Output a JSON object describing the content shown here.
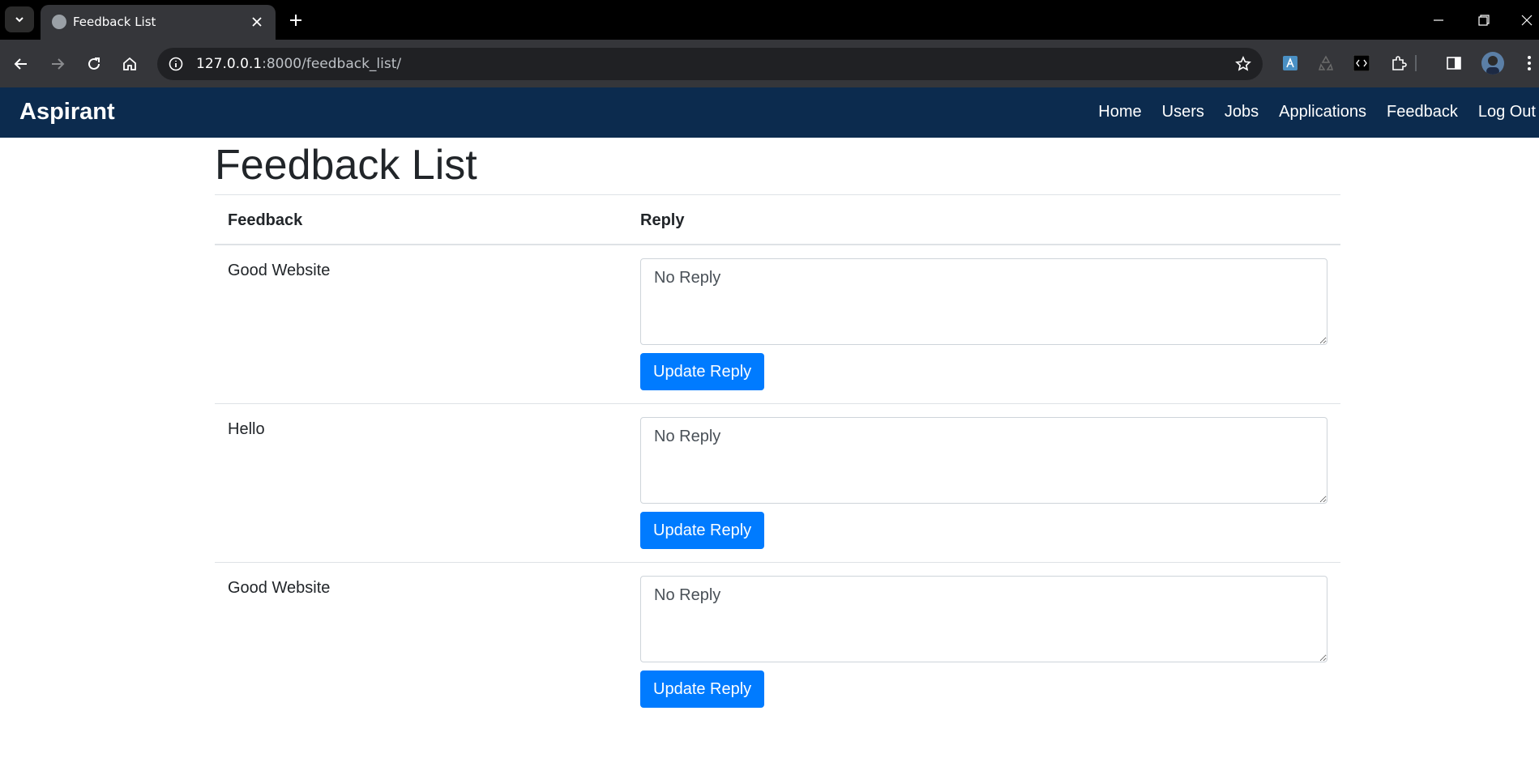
{
  "browser": {
    "tab_title": "Feedback List",
    "url_host": "127.0.0.1",
    "url_rest": ":8000/feedback_list/"
  },
  "navbar": {
    "brand": "Aspirant",
    "links": [
      "Home",
      "Users",
      "Jobs",
      "Applications",
      "Feedback",
      "Log Out"
    ]
  },
  "page": {
    "title": "Feedback List",
    "columns": {
      "feedback": "Feedback",
      "reply": "Reply"
    },
    "rows": [
      {
        "feedback": "Good Website",
        "reply": "No Reply",
        "button": "Update Reply"
      },
      {
        "feedback": "Hello",
        "reply": "No Reply",
        "button": "Update Reply"
      },
      {
        "feedback": "Good Website",
        "reply": "No Reply",
        "button": "Update Reply"
      }
    ]
  },
  "colors": {
    "navbar": "#0c2b4e",
    "button": "#007bff"
  }
}
